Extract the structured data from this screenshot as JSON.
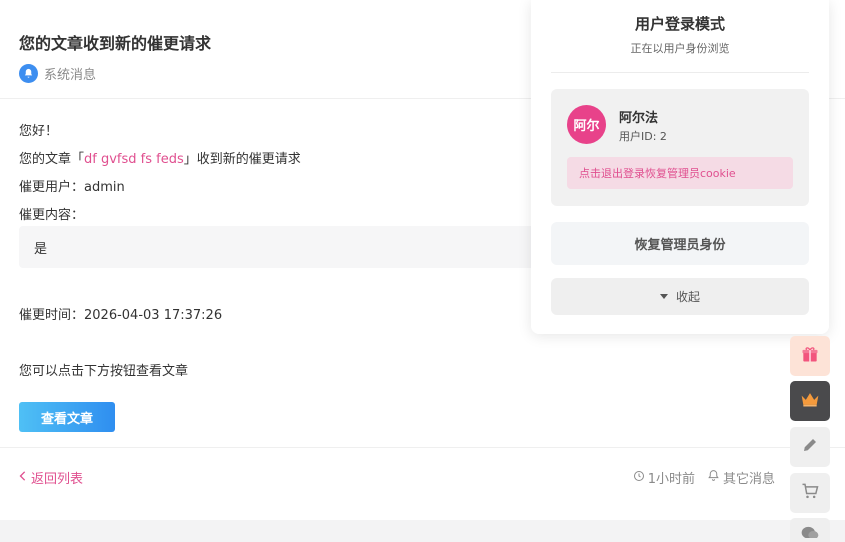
{
  "message": {
    "title": "您的文章收到新的催更请求",
    "source": "系统消息",
    "greeting": "您好！",
    "article_prefix": "您的文章「",
    "article_name": "df gvfsd fs  feds",
    "article_suffix": "」收到新的催更请求",
    "user_label": "催更用户：",
    "user_value": "admin",
    "content_label": "催更内容：",
    "content_value": "是",
    "time_label": "催更时间：",
    "time_value": "2026-04-03 17:37:26",
    "hint": "您可以点击下方按钮查看文章",
    "view_button": "查看文章"
  },
  "footer": {
    "back_label": "返回列表",
    "time_ago": "1小时前",
    "other_messages": "其它消息"
  },
  "login_panel": {
    "title": "用户登录模式",
    "subtitle": "正在以用户身份浏览",
    "avatar_text": "阿尔",
    "user_name": "阿尔法",
    "user_id": "用户ID: 2",
    "logout_label": "点击退出登录恢复管理员cookie",
    "restore_label": "恢复管理员身份",
    "collapse_label": "收起"
  },
  "colors": {
    "accent_pink": "#e04f8f",
    "accent_blue": "#2f8ef0"
  },
  "toolbar_icons": [
    "gift-icon",
    "crown-icon",
    "pencil-icon",
    "cart-icon",
    "wechat-icon"
  ]
}
